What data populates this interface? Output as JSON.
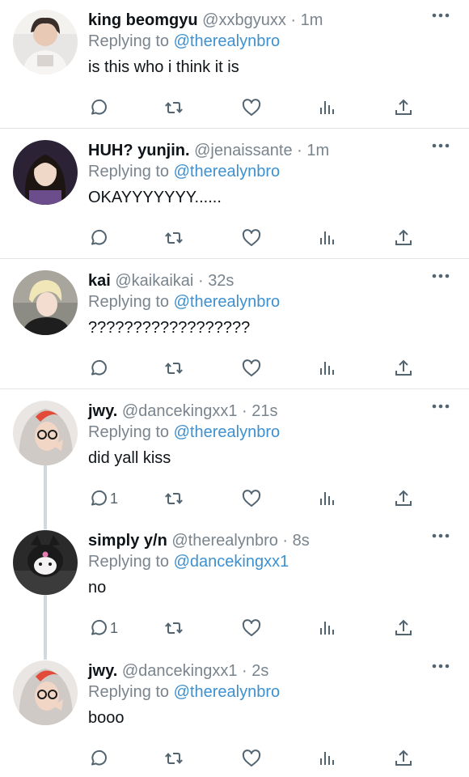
{
  "tweets": [
    {
      "name": "king beomgyu",
      "handle": "@xxbgyuxx",
      "time": "1m",
      "replying_prefix": "Replying to",
      "replying_to": "@therealynbro",
      "text": "is this who i think it is",
      "reply_count": ""
    },
    {
      "name": "HUH? yunjin.",
      "handle": "@jenaissante",
      "time": "1m",
      "replying_prefix": "Replying to",
      "replying_to": "@therealynbro",
      "text": "OKAYYYYYYY......",
      "reply_count": ""
    },
    {
      "name": "kai",
      "handle": "@kaikaikai",
      "time": "32s",
      "replying_prefix": "Replying to",
      "replying_to": "@therealynbro",
      "text": "??????????????????",
      "reply_count": ""
    },
    {
      "name": "jwy.",
      "handle": "@dancekingxx1",
      "time": "21s",
      "replying_prefix": "Replying to",
      "replying_to": "@therealynbro",
      "text": "did yall kiss",
      "reply_count": "1"
    },
    {
      "name": "simply y/n",
      "handle": "@therealynbro",
      "time": "8s",
      "replying_prefix": "Replying to",
      "replying_to": "@dancekingxx1",
      "text": "no",
      "reply_count": "1"
    },
    {
      "name": "jwy.",
      "handle": "@dancekingxx1",
      "time": "2s",
      "replying_prefix": "Replying to",
      "replying_to": "@therealynbro",
      "text": "booo",
      "reply_count": ""
    }
  ],
  "separator": "·",
  "icons": {
    "reply": "reply-icon",
    "retweet": "retweet-icon",
    "like": "heart-icon",
    "views": "views-icon",
    "share": "share-icon",
    "more": "more-icon"
  },
  "colors": {
    "link": "#3e90cf",
    "muted": "#7a848d",
    "icon": "#536471",
    "divider": "#e1e4e7"
  }
}
